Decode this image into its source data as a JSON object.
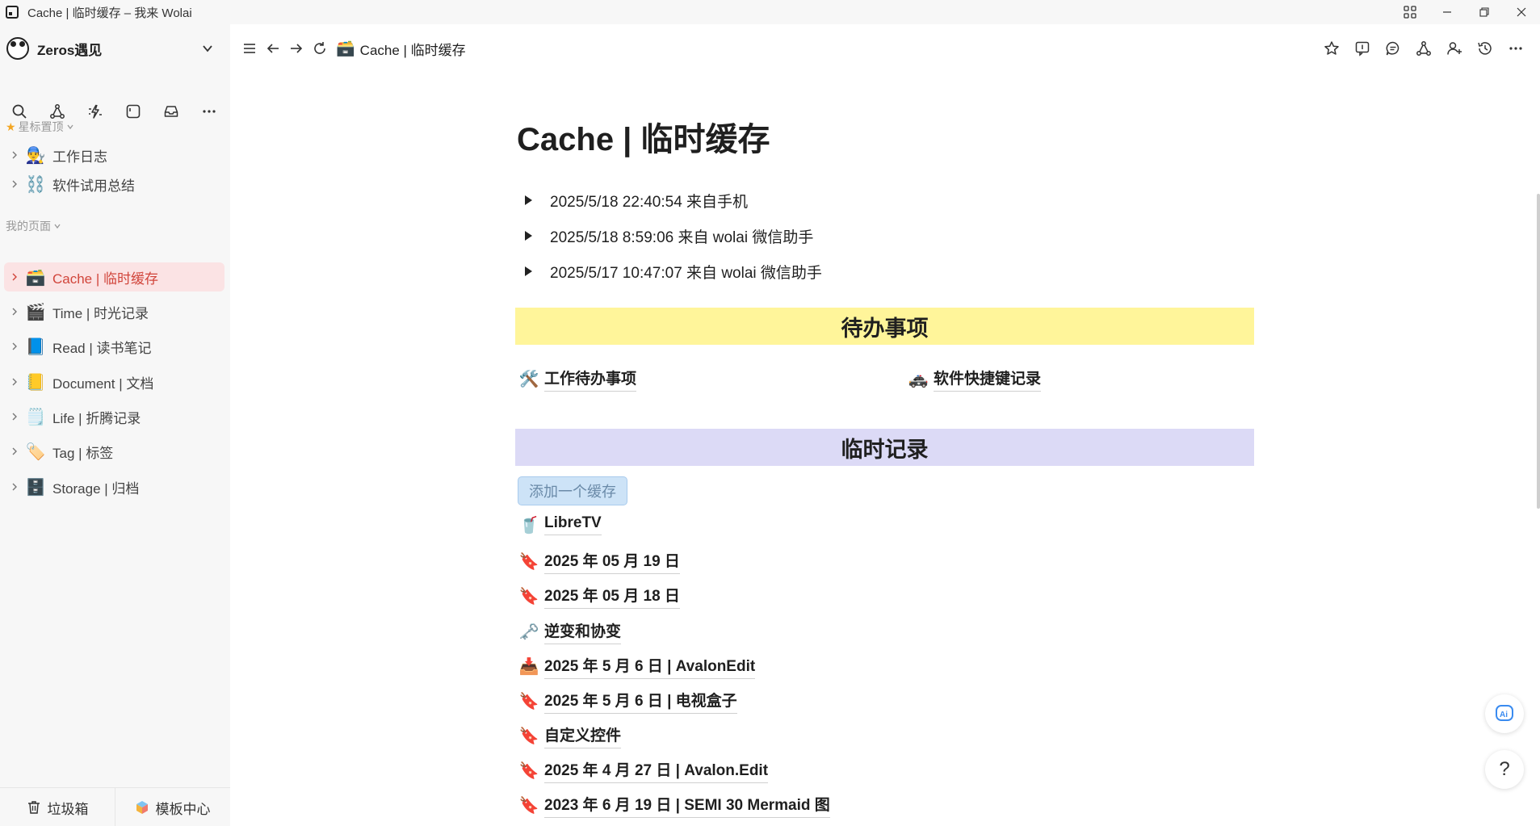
{
  "window": {
    "title": "Cache | 临时缓存 – 我来 Wolai"
  },
  "sidebar": {
    "workspace_name": "Zeros遇见",
    "starred_label": "星标置顶",
    "starred": [
      {
        "label": "工作日志",
        "emoji": "👨‍🔧"
      },
      {
        "label": "软件试用总结",
        "emoji": "⛓️"
      }
    ],
    "pages_label": "我的页面",
    "pages": [
      {
        "label": "Cache | 临时缓存",
        "emoji": "🗃️"
      },
      {
        "label": "Time | 时光记录",
        "emoji": "🎬"
      },
      {
        "label": "Read | 读书笔记",
        "emoji": "📘"
      },
      {
        "label": "Document | 文档",
        "emoji": "📒"
      },
      {
        "label": "Life | 折腾记录",
        "emoji": "🗒️"
      },
      {
        "label": "Tag | 标签",
        "emoji": "🏷️"
      },
      {
        "label": "Storage | 归档",
        "emoji": "🗄️"
      }
    ],
    "footer": {
      "trash": "垃圾箱",
      "templates": "模板中心"
    }
  },
  "topbar": {
    "breadcrumb": "Cache | 临时缓存",
    "breadcrumb_emoji": "🗃️"
  },
  "page": {
    "title": "Cache | 临时缓存",
    "toggles": [
      "2025/5/18 22:40:54 来自手机",
      "2025/5/18 8:59:06 来自 wolai 微信助手",
      "2025/5/17 10:47:07 来自 wolai 微信助手"
    ],
    "todo_banner": "待办事项",
    "todo_links": [
      {
        "label": "工作待办事项",
        "emoji": "🛠️"
      },
      {
        "label": "软件快捷键记录",
        "emoji": "🚓"
      }
    ],
    "temp_banner": "临时记录",
    "add_button": "添加一个缓存",
    "records": [
      {
        "label": "LibreTV",
        "emoji": "🥤"
      },
      {
        "label": "2025 年 05 月 19 日",
        "emoji": "🔖"
      },
      {
        "label": "2025 年 05 月 18 日",
        "emoji": "🔖"
      },
      {
        "label": "逆变和协变",
        "emoji": "🗝️"
      },
      {
        "label": "2025 年 5 月 6 日 | AvalonEdit",
        "emoji": "📥"
      },
      {
        "label": "2025 年 5 月 6 日 | 电视盒子",
        "emoji": "🔖"
      },
      {
        "label": "自定义控件",
        "emoji": "🔖"
      },
      {
        "label": "2025 年 4 月 27 日 | Avalon.Edit",
        "emoji": "🔖"
      },
      {
        "label": "2023 年 6 月 19 日 | SEMI 30 Mermaid 图",
        "emoji": "🔖"
      }
    ]
  },
  "floating": {
    "help": "?"
  },
  "colors": {
    "active_bg": "#fbe3e4",
    "active_text": "#d1453b",
    "yellow_banner": "#fff59a",
    "purple_banner": "#dcdaf6",
    "add_button_bg": "#cde3f7"
  }
}
